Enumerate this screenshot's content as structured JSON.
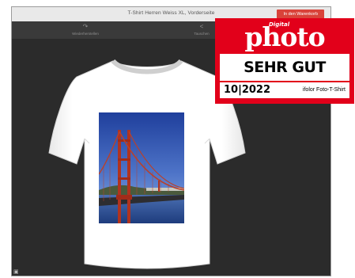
{
  "window": {
    "title": "T-Shirt Herren Weiss XL, Vorderseite",
    "cart_button": "In den Warenkorb"
  },
  "toolbar": {
    "items": [
      {
        "label": "Wiederherstellen",
        "icon": "redo-icon"
      },
      {
        "label": "Tauschen",
        "icon": "share-icon"
      }
    ]
  },
  "product": {
    "garment_color": "#ffffff",
    "print_image": "golden-gate-bridge-photo"
  },
  "badge": {
    "digital": "Digital",
    "brand": "photo",
    "rating": "SEHR GUT",
    "issue": "10|2022",
    "product": "ifolor Foto-T-Shirt",
    "color": "#e2001a"
  },
  "colors": {
    "accent": "#d9433a",
    "canvas_bg": "#2b2b2b"
  }
}
